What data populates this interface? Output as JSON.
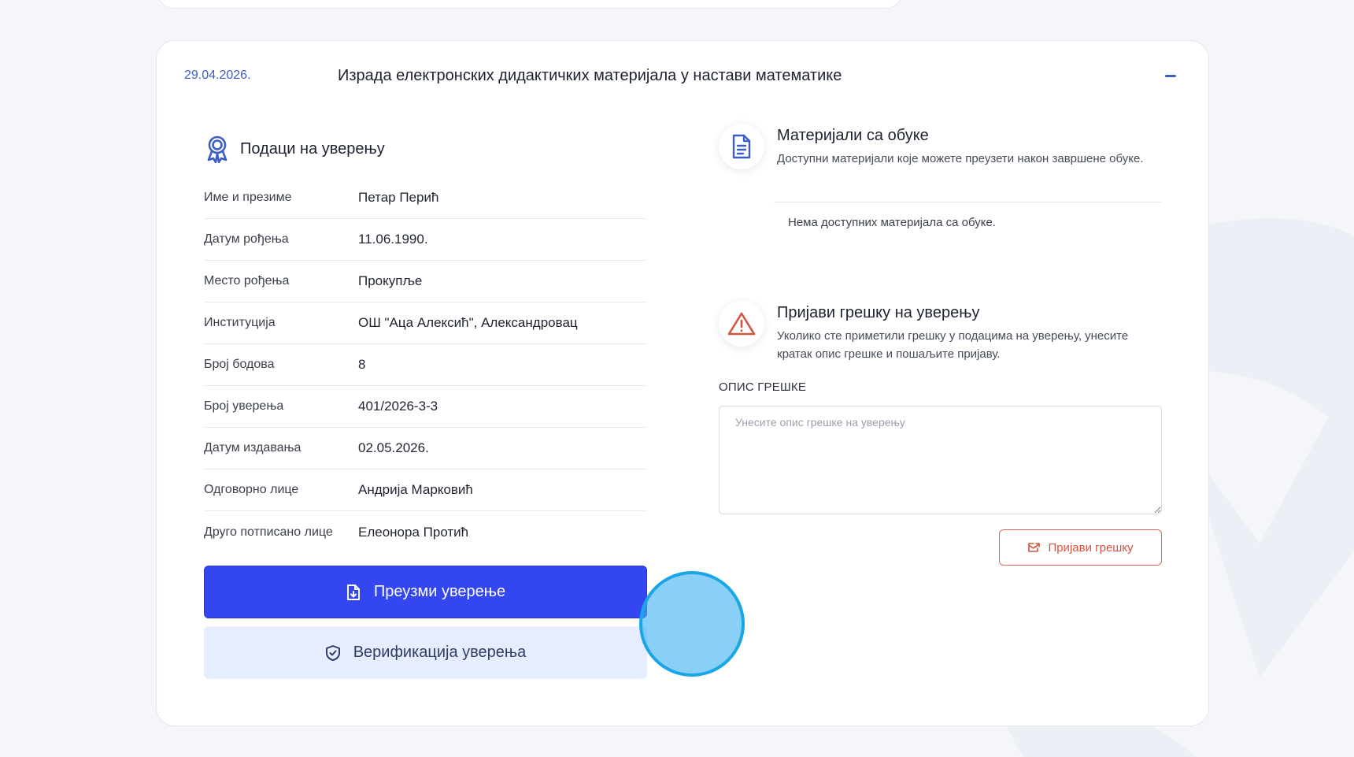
{
  "card": {
    "date": "29.04.2026.",
    "title": "Израда електронских дидактичких материјала у настави математике"
  },
  "certificate": {
    "section_title": "Подаци на уверењу",
    "rows": [
      {
        "label": "Име и презиме",
        "value": "Петар Перић"
      },
      {
        "label": "Датум рођења",
        "value": "11.06.1990."
      },
      {
        "label": "Место рођења",
        "value": "Прокупље"
      },
      {
        "label": "Институција",
        "value": "ОШ \"Аца Алексић\", Александровац"
      },
      {
        "label": "Број бодова",
        "value": "8"
      },
      {
        "label": "Број уверења",
        "value": "401/2026-3-3"
      },
      {
        "label": "Датум издавања",
        "value": "02.05.2026."
      },
      {
        "label": "Одговорно лице",
        "value": "Андрија Марковић"
      },
      {
        "label": "Друго потписано лице",
        "value": "Елеонора Протић"
      }
    ],
    "download_label": "Преузми уверење",
    "verify_label": "Верификација уверења"
  },
  "materials": {
    "title": "Материјали са обуке",
    "description": "Доступни материјали које можете преузети након завршене обуке.",
    "empty_text": "Нема доступних материјала са обуке."
  },
  "report": {
    "title": "Пријави грешку на уверењу",
    "description": "Уколико сте приметили грешку у подацима на уверењу, унесите кратак опис грешке и пошаљите пријаву.",
    "field_label": "ОПИС ГРЕШКЕ",
    "placeholder": "Унесите опис грешке на уверењу",
    "button_label": "Пријави грешку"
  },
  "colors": {
    "primary": "#3446f0",
    "accent": "#3d5fc4",
    "danger": "#d4553f",
    "verify_bg": "#e5edfe"
  }
}
